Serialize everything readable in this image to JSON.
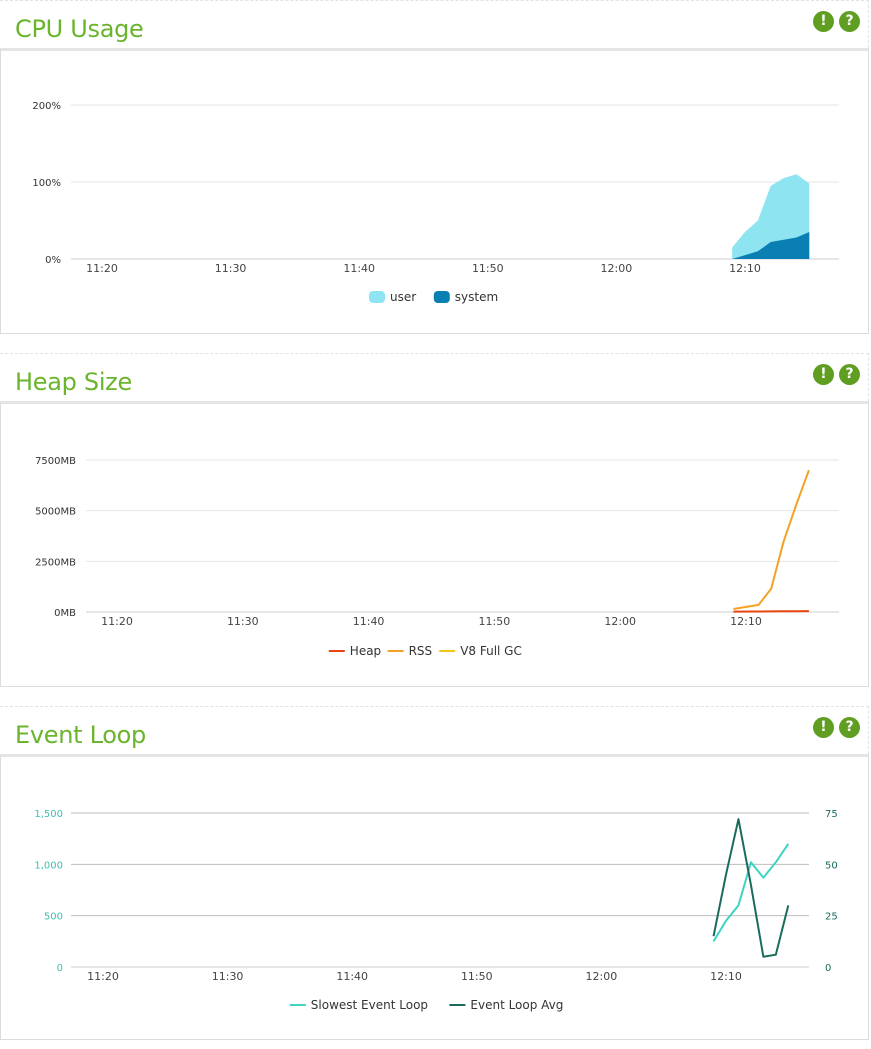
{
  "panels": [
    {
      "title": "CPU Usage",
      "chart_data": {
        "type": "area",
        "x": [
          "12:09",
          "12:10",
          "12:11",
          "12:12",
          "12:13",
          "12:14",
          "12:15"
        ],
        "xticks": [
          "11:20",
          "11:30",
          "11:40",
          "11:50",
          "12:00",
          "12:10"
        ],
        "yticks": [
          "0%",
          "100%",
          "200%"
        ],
        "ylim": [
          0,
          200
        ],
        "series": [
          {
            "name": "user",
            "color": "#8ee4f0",
            "values": [
              15,
              35,
              50,
              95,
              105,
              110,
              98
            ]
          },
          {
            "name": "system",
            "color": "#0a7fb4",
            "values": [
              0,
              5,
              10,
              22,
              25,
              28,
              35
            ]
          }
        ],
        "legend_position": "bottom"
      }
    },
    {
      "title": "Heap Size",
      "chart_data": {
        "type": "line",
        "x": [
          "12:09",
          "12:11",
          "12:12",
          "12:13",
          "12:14",
          "12:15"
        ],
        "xticks": [
          "11:20",
          "11:30",
          "11:40",
          "11:50",
          "12:00",
          "12:10"
        ],
        "yticks": [
          "0MB",
          "2500MB",
          "5000MB",
          "7500MB"
        ],
        "ylim": [
          0,
          7500
        ],
        "series": [
          {
            "name": "Heap",
            "color": "#e8440f",
            "values": [
              20,
              25,
              30,
              35,
              40,
              45
            ]
          },
          {
            "name": "RSS",
            "color": "#f4a225",
            "values": [
              150,
              350,
              1150,
              3500,
              5300,
              7000
            ]
          },
          {
            "name": "V8 Full GC",
            "color": "#f6c614",
            "values": []
          }
        ],
        "legend_position": "bottom"
      }
    },
    {
      "title": "Event Loop",
      "chart_data": {
        "type": "line",
        "x": [
          "12:09",
          "12:10",
          "12:11",
          "12:12",
          "12:13",
          "12:14",
          "12:15"
        ],
        "xticks": [
          "11:20",
          "11:30",
          "11:40",
          "11:50",
          "12:00",
          "12:10"
        ],
        "yticks_left": [
          "0",
          "500",
          "1,000",
          "1,500"
        ],
        "yticks_right": [
          "0",
          "25",
          "50",
          "75"
        ],
        "ylim_left": [
          0,
          1500
        ],
        "ylim_right": [
          0,
          75
        ],
        "series": [
          {
            "name": "Slowest Event Loop",
            "color": "#3fd4c0",
            "axis": "left",
            "values": [
              250,
              450,
              600,
              1020,
              870,
              1020,
              1200
            ]
          },
          {
            "name": "Event Loop Avg",
            "color": "#1a6b5c",
            "axis": "right",
            "values": [
              15,
              45,
              72,
              40,
              5,
              6,
              30
            ]
          }
        ],
        "legend_position": "bottom"
      }
    }
  ],
  "icons": {
    "alert": "!",
    "help": "?"
  },
  "colors": {
    "title_green": "#6ab42e",
    "icon_green": "#5f9e21",
    "left_axis": "#3fbfb0",
    "right_axis": "#1a6b5c"
  }
}
